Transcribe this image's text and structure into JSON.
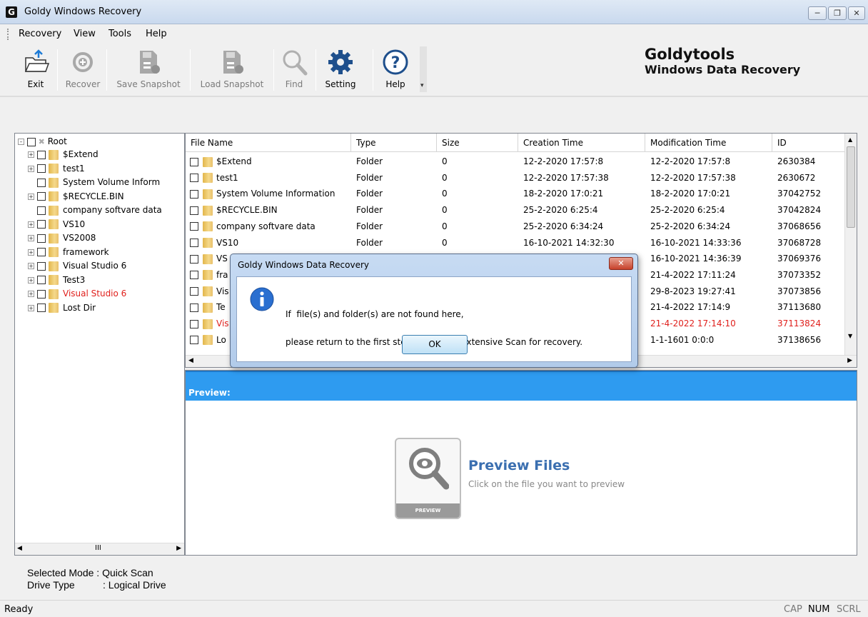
{
  "window": {
    "title": "Goldy Windows Recovery",
    "icon_letter": "G"
  },
  "menu": [
    "Recovery",
    "View",
    "Tools",
    "Help"
  ],
  "toolbar": {
    "exit": "Exit",
    "recover": "Recover",
    "save_snapshot": "Save Snapshot",
    "load_snapshot": "Load Snapshot",
    "find": "Find",
    "setting": "Setting",
    "help": "Help"
  },
  "brand": {
    "name": "Goldytools",
    "tagline": "Windows Data Recovery"
  },
  "tree": {
    "root": "Root",
    "items": [
      {
        "label": "$Extend",
        "expandable": true
      },
      {
        "label": "test1",
        "expandable": true
      },
      {
        "label": "System Volume Inform",
        "expandable": false
      },
      {
        "label": "$RECYCLE.BIN",
        "expandable": true
      },
      {
        "label": "company softvare data",
        "expandable": false
      },
      {
        "label": "VS10",
        "expandable": true
      },
      {
        "label": "VS2008",
        "expandable": true
      },
      {
        "label": "framework",
        "expandable": true
      },
      {
        "label": "Visual Studio 6",
        "expandable": true
      },
      {
        "label": "Test3",
        "expandable": true
      },
      {
        "label": "Visual Studio 6",
        "expandable": true,
        "deleted": true
      },
      {
        "label": "Lost Dir",
        "expandable": true
      }
    ]
  },
  "grid": {
    "columns": [
      "File Name",
      "Type",
      "Size",
      "Creation Time",
      "Modification Time",
      "ID"
    ],
    "rows": [
      {
        "name": "$Extend",
        "type": "Folder",
        "size": "0",
        "created": "12-2-2020 17:57:8",
        "modified": "12-2-2020 17:57:8",
        "id": "2630384"
      },
      {
        "name": "test1",
        "type": "Folder",
        "size": "0",
        "created": "12-2-2020 17:57:38",
        "modified": "12-2-2020 17:57:38",
        "id": "2630672"
      },
      {
        "name": "System Volume Information",
        "type": "Folder",
        "size": "0",
        "created": "18-2-2020 17:0:21",
        "modified": "18-2-2020 17:0:21",
        "id": "37042752"
      },
      {
        "name": "$RECYCLE.BIN",
        "type": "Folder",
        "size": "0",
        "created": "25-2-2020 6:25:4",
        "modified": "25-2-2020 6:25:4",
        "id": "37042824"
      },
      {
        "name": "company softvare data",
        "type": "Folder",
        "size": "0",
        "created": "25-2-2020 6:34:24",
        "modified": "25-2-2020 6:34:24",
        "id": "37068656"
      },
      {
        "name": "VS10",
        "type": "Folder",
        "size": "0",
        "created": "16-10-2021 14:32:30",
        "modified": "16-10-2021 14:33:36",
        "id": "37068728"
      },
      {
        "name": "VS",
        "type": "",
        "size": "",
        "created": "",
        "modified": "16-10-2021 14:36:39",
        "id": "37069376"
      },
      {
        "name": "fra",
        "type": "",
        "size": "",
        "created": "",
        "modified": "21-4-2022 17:11:24",
        "id": "37073352"
      },
      {
        "name": "Vis",
        "type": "",
        "size": "",
        "created": "",
        "modified": "29-8-2023 19:27:41",
        "id": "37073856"
      },
      {
        "name": "Te",
        "type": "",
        "size": "",
        "created": "",
        "modified": "21-4-2022 17:14:9",
        "id": "37113680"
      },
      {
        "name": "Vis",
        "type": "",
        "size": "",
        "created": "",
        "modified": "21-4-2022 17:14:10",
        "id": "37113824",
        "deleted": true
      },
      {
        "name": "Lo",
        "type": "",
        "size": "",
        "created": "",
        "modified": "1-1-1601 0:0:0",
        "id": "37138656"
      }
    ]
  },
  "preview": {
    "header": "Preview:",
    "title": "Preview Files",
    "subtitle": "Click on the file you want to preview",
    "card_label": "PREVIEW"
  },
  "info": {
    "mode_label": "Selected Mode",
    "mode_value": "Quick Scan",
    "drive_label": "Drive Type",
    "drive_value": "Logical Drive"
  },
  "status": {
    "text": "Ready",
    "cap": "CAP",
    "num": "NUM",
    "scrl": "SCRL"
  },
  "dialog": {
    "title": "Goldy Windows Data Recovery",
    "line1": "If  file(s) and folder(s) are not found here,",
    "line2": "please return to the first step and select Extensive Scan for recovery.",
    "ok": "OK"
  },
  "colors": {
    "accent": "#2e9bf0",
    "deleted": "#e0201c",
    "brand_blue": "#3b6fb0"
  }
}
